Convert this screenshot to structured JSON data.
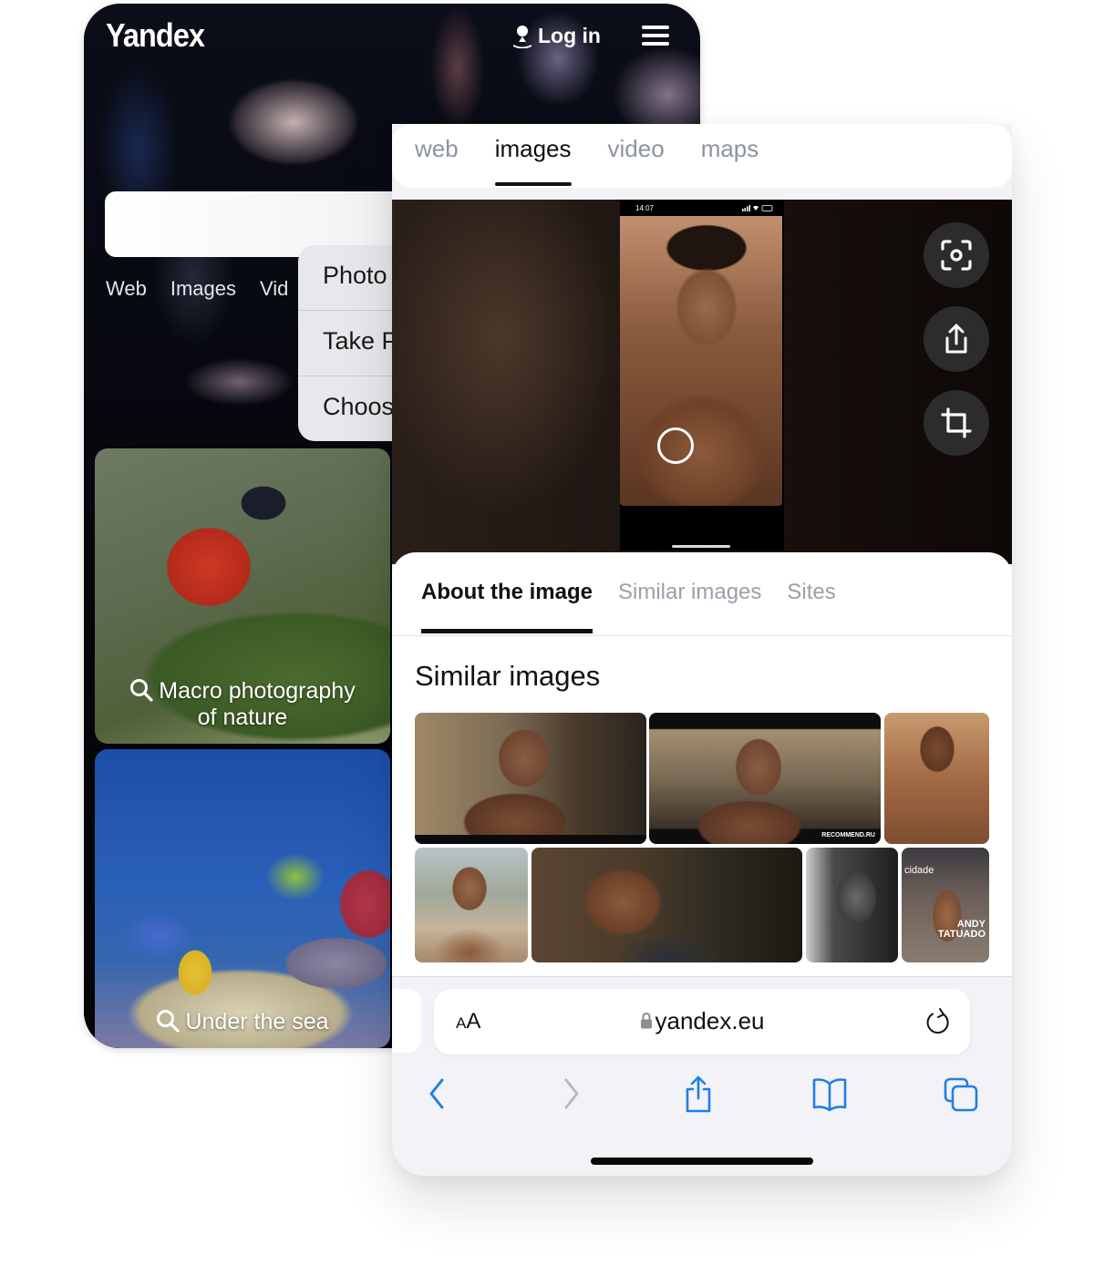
{
  "back_phone": {
    "logo": "Yandex",
    "login_label": "Log in",
    "nav_items": [
      "Web",
      "Images",
      "Vid"
    ],
    "context_menu": [
      "Photo",
      "Take P",
      "Choos"
    ],
    "cards": [
      {
        "label_line1": "Macro photography",
        "label_line2": "of nature"
      },
      {
        "label_line1": "Under the sea",
        "label_line2": ""
      }
    ]
  },
  "front_phone": {
    "top_tabs": [
      {
        "label": "web",
        "active": false
      },
      {
        "label": "images",
        "active": true
      },
      {
        "label": "video",
        "active": false
      },
      {
        "label": "maps",
        "active": false
      }
    ],
    "viewer": {
      "status_time": "14:07",
      "buttons": [
        "scan-icon",
        "share-icon",
        "crop-icon"
      ]
    },
    "sheet": {
      "tabs": [
        {
          "label": "About the image",
          "active": true
        },
        {
          "label": "Similar images",
          "active": false
        },
        {
          "label": "Sites",
          "active": false
        }
      ],
      "heading": "Similar images",
      "thumbnail_captions": {
        "recommend_watermark": "RECOMMEND.RU",
        "magazine_title": "cidade",
        "magazine_name_line1": "ANDY",
        "magazine_name_line2": "TATUADO"
      }
    },
    "browser": {
      "text_size_label_small": "A",
      "text_size_label_large": "A",
      "url": "yandex.eu",
      "toolbar": [
        "back-icon",
        "forward-icon",
        "share-icon",
        "bookmarks-icon",
        "tabs-icon"
      ]
    }
  },
  "colors": {
    "ios_blue": "#1f7fe5",
    "inactive_tab": "#8d93a1",
    "disabled_gray": "#b8b8bd"
  }
}
